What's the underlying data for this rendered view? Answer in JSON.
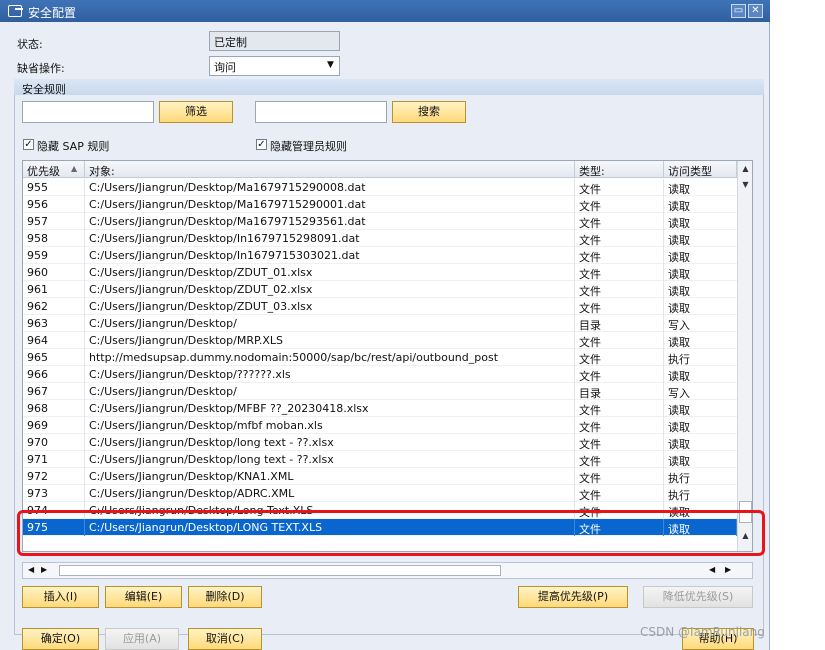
{
  "window": {
    "title": "安全配置"
  },
  "form": {
    "status_label": "状态:",
    "status_value": "已定制",
    "default_op_label": "缺省操作:",
    "default_op_value": "询问"
  },
  "rules_group": {
    "title": "安全规则",
    "filter_button": "筛选",
    "search_button": "搜索",
    "hide_sap_label": "隐藏 SAP 规则",
    "hide_sap_checked": true,
    "hide_admin_label": "隐藏管理员规则",
    "hide_admin_checked": true
  },
  "table": {
    "columns": [
      "优先级",
      "对象:",
      "类型:",
      "访问类型"
    ],
    "rows": [
      [
        "955",
        "C:/Users/Jiangrun/Desktop/Ma1679715290008.dat",
        "文件",
        "读取"
      ],
      [
        "956",
        "C:/Users/Jiangrun/Desktop/Ma1679715290001.dat",
        "文件",
        "读取"
      ],
      [
        "957",
        "C:/Users/Jiangrun/Desktop/Ma1679715293561.dat",
        "文件",
        "读取"
      ],
      [
        "958",
        "C:/Users/Jiangrun/Desktop/In1679715298091.dat",
        "文件",
        "读取"
      ],
      [
        "959",
        "C:/Users/Jiangrun/Desktop/In1679715303021.dat",
        "文件",
        "读取"
      ],
      [
        "960",
        "C:/Users/Jiangrun/Desktop/ZDUT_01.xlsx",
        "文件",
        "读取"
      ],
      [
        "961",
        "C:/Users/Jiangrun/Desktop/ZDUT_02.xlsx",
        "文件",
        "读取"
      ],
      [
        "962",
        "C:/Users/Jiangrun/Desktop/ZDUT_03.xlsx",
        "文件",
        "读取"
      ],
      [
        "963",
        "C:/Users/Jiangrun/Desktop/",
        "目录",
        "写入"
      ],
      [
        "964",
        "C:/Users/Jiangrun/Desktop/MRP.XLS",
        "文件",
        "读取"
      ],
      [
        "965",
        "http://medsupsap.dummy.nodomain:50000/sap/bc/rest/api/outbound_post",
        "文件",
        "执行"
      ],
      [
        "966",
        "C:/Users/Jiangrun/Desktop/??????.xls",
        "文件",
        "读取"
      ],
      [
        "967",
        "C:/Users/Jiangrun/Desktop/",
        "目录",
        "写入"
      ],
      [
        "968",
        "C:/Users/Jiangrun/Desktop/MFBF ??_20230418.xlsx",
        "文件",
        "读取"
      ],
      [
        "969",
        "C:/Users/Jiangrun/Desktop/mfbf moban.xls",
        "文件",
        "读取"
      ],
      [
        "970",
        "C:/Users/Jiangrun/Desktop/long text - ??.xlsx",
        "文件",
        "读取"
      ],
      [
        "971",
        "C:/Users/Jiangrun/Desktop/long text - ??.xlsx",
        "文件",
        "读取"
      ],
      [
        "972",
        "C:/Users/Jiangrun/Desktop/KNA1.XML",
        "文件",
        "执行"
      ],
      [
        "973",
        "C:/Users/Jiangrun/Desktop/ADRC.XML",
        "文件",
        "执行"
      ],
      [
        "974",
        "C:/Users/Jiangrun/Desktop/Long Text.XLS",
        "文件",
        "读取"
      ],
      [
        "975",
        "C:/Users/Jiangrun/Desktop/LONG TEXT.XLS",
        "文件",
        "读取"
      ]
    ],
    "selected_priority": "975"
  },
  "table_buttons": {
    "insert": "插入(I)",
    "edit": "编辑(E)",
    "delete": "删除(D)",
    "raise_priority": "提高优先级(P)",
    "lower_priority": "降低优先级(S)"
  },
  "footer_buttons": {
    "ok": "确定(O)",
    "apply": "应用(A)",
    "cancel": "取消(C)",
    "help": "帮助(H)"
  },
  "watermark": "CSDN @IamRunjiang",
  "colors": {
    "selection": "#0a66cf",
    "highlight": "#e8141c",
    "titlebar": "#2f5f9f"
  }
}
